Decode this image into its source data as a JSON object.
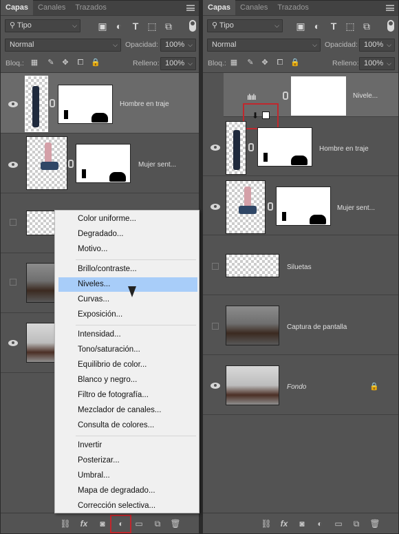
{
  "left_panel": {
    "tabs": [
      "Capas",
      "Canales",
      "Trazados"
    ],
    "filter_kind": "Tipo",
    "blend_mode": "Normal",
    "opacity_label": "Opacidad:",
    "opacity_value": "100%",
    "lock_label": "Bloq.:",
    "fill_label": "Relleno:",
    "fill_value": "100%",
    "layers": [
      "Hombre en traje",
      "Mujer sent..."
    ]
  },
  "right_panel": {
    "tabs": [
      "Capas",
      "Canales",
      "Trazados"
    ],
    "filter_kind": "Tipo",
    "blend_mode": "Normal",
    "opacity_label": "Opacidad:",
    "opacity_value": "100%",
    "lock_label": "Bloq.:",
    "fill_label": "Relleno:",
    "fill_value": "100%",
    "layers": [
      "Nivele...",
      "Hombre en traje",
      "Mujer sent...",
      "Siluetas",
      "Captura de pantalla",
      "Fondo"
    ]
  },
  "adjustment_menu": {
    "items": [
      "Color uniforme...",
      "Degradado...",
      "Motivo...",
      "Brillo/contraste...",
      "Niveles...",
      "Curvas...",
      "Exposición...",
      "Intensidad...",
      "Tono/saturación...",
      "Equilibrio de color...",
      "Blanco y negro...",
      "Filtro de fotografía...",
      "Mezclador de canales...",
      "Consulta de colores...",
      "Invertir",
      "Posterizar...",
      "Umbral...",
      "Mapa de degradado...",
      "Corrección selectiva..."
    ],
    "highlighted": "Niveles..."
  },
  "bottom_icons": [
    "link-icon",
    "fx-icon",
    "mask-icon",
    "adjustment-icon",
    "folder-icon",
    "new-layer-icon",
    "trash-icon"
  ],
  "colors": {
    "highlight": "#a8cdf9",
    "red_box": "#c1272d",
    "panel": "#535353"
  }
}
